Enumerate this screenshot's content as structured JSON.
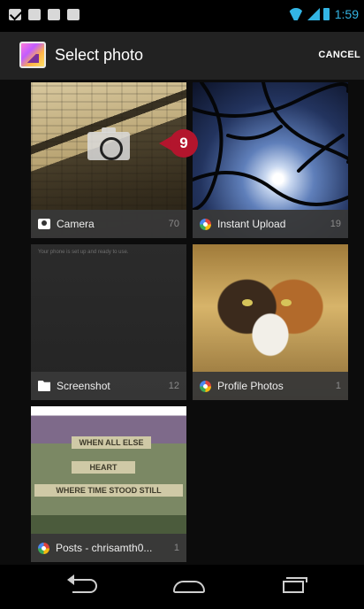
{
  "status_bar": {
    "time": "1:59",
    "left_icons": [
      "mail-icon",
      "voicemail-icon",
      "image-icon",
      "bag-icon"
    ],
    "right_icons": [
      "wifi-icon",
      "signal-icon",
      "battery-icon"
    ],
    "accent": "#33b5e5"
  },
  "action_bar": {
    "title": "Select photo",
    "cancel_label": "CANCEL",
    "app_icon": "gallery-app-icon"
  },
  "albums": [
    {
      "name": "Camera",
      "count": "70",
      "icon": "camera-icon"
    },
    {
      "name": "Instant Upload",
      "count": "19",
      "icon": "picasa-icon"
    },
    {
      "name": "Screenshot",
      "count": "12",
      "icon": "folder-icon",
      "notice": "Your phone is set up and ready to use."
    },
    {
      "name": "Profile Photos",
      "count": "1",
      "icon": "picasa-icon"
    },
    {
      "name": "Posts - chrisamth0...",
      "count": "1",
      "icon": "picasa-icon",
      "signs": [
        "WHEN ALL ELSE",
        "HEART",
        "WHERE TIME STOOD STILL"
      ]
    }
  ],
  "callout": {
    "number": "9",
    "color": "#b3152d"
  },
  "nav_bar": {
    "buttons": [
      "back-icon",
      "home-icon",
      "recent-apps-icon"
    ]
  }
}
